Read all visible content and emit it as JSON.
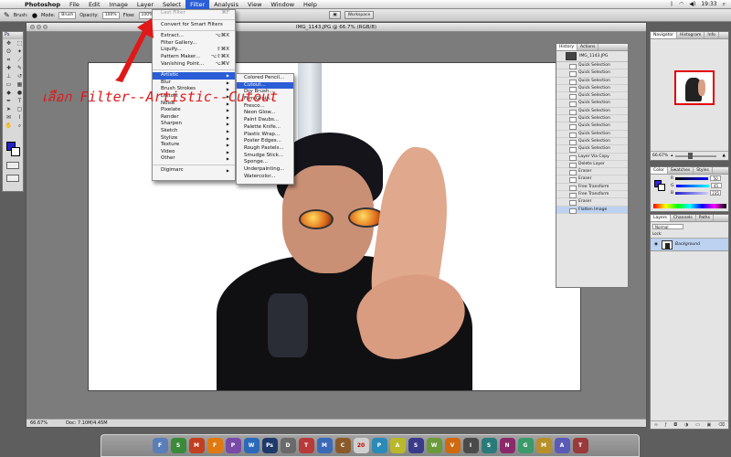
{
  "menubar": {
    "app": "Photoshop",
    "items": [
      "File",
      "Edit",
      "Image",
      "Layer",
      "Select",
      "Filter",
      "Analysis",
      "View",
      "Window",
      "Help"
    ],
    "active_item": "Filter",
    "clock": "19:33"
  },
  "options_bar": {
    "brush_label": "Brush:",
    "mode_label": "Mode:",
    "mode_value": "Brush",
    "opacity_label": "Opacity:",
    "opacity_value": "100%",
    "flow_label": "Flow:",
    "flow_value": "100%",
    "workspace_label": "Workspace"
  },
  "toolbox": {
    "title": "Ps"
  },
  "document": {
    "title": "IMG_1143.JPG @ 66.7% (RGB/8)",
    "zoom": "66.67%",
    "doc_size": "Doc: 7.10M/4.45M"
  },
  "filter_menu": {
    "last_filter": "Last Filter",
    "last_filter_shortcut": "⌘F",
    "convert": "Convert for Smart Filters",
    "top_items": [
      {
        "label": "Extract...",
        "shortcut": "⌥⌘X"
      },
      {
        "label": "Filter Gallery...",
        "shortcut": ""
      },
      {
        "label": "Liquify...",
        "shortcut": "⇧⌘X"
      },
      {
        "label": "Pattern Maker...",
        "shortcut": "⌥⇧⌘X"
      },
      {
        "label": "Vanishing Point...",
        "shortcut": "⌥⌘V"
      }
    ],
    "categories": [
      "Artistic",
      "Blur",
      "Brush Strokes",
      "Distort",
      "Noise",
      "Pixelate",
      "Render",
      "Sharpen",
      "Sketch",
      "Stylize",
      "Texture",
      "Video",
      "Other"
    ],
    "highlighted": "Artistic",
    "bottom": "Digimarc"
  },
  "artistic_submenu": {
    "items": [
      "Colored Pencil...",
      "Cutout...",
      "Dry Brush...",
      "Film Grain...",
      "Fresco...",
      "Neon Glow...",
      "Paint Daubs...",
      "Palette Knife...",
      "Plastic Wrap...",
      "Poster Edges...",
      "Rough Pastels...",
      "Smudge Stick...",
      "Sponge...",
      "Underpainting...",
      "Watercolor..."
    ],
    "highlighted": "Cutout..."
  },
  "annotation": {
    "text": "เลือก Filter--Artistic--Cutout",
    "color": "#e01818"
  },
  "history": {
    "tabs": [
      "History",
      "Actions"
    ],
    "snapshot": "IMG_1143.JPG",
    "states": [
      "Quick Selection",
      "Quick Selection",
      "Quick Selection",
      "Quick Selection",
      "Quick Selection",
      "Quick Selection",
      "Quick Selection",
      "Quick Selection",
      "Quick Selection",
      "Quick Selection",
      "Quick Selection",
      "Quick Selection",
      "Layer Via Copy",
      "Delete Layer",
      "Eraser",
      "Eraser",
      "Free Transform",
      "Free Transform",
      "Eraser",
      "Flatten Image"
    ],
    "selected_index": 19
  },
  "navigator": {
    "tabs": [
      "Navigator",
      "Histogram",
      "Info"
    ],
    "zoom": "66.67%"
  },
  "color_panel": {
    "tabs": [
      "Color",
      "Swatches",
      "Styles"
    ],
    "channels": [
      {
        "label": "R",
        "value": "50"
      },
      {
        "label": "G",
        "value": "45"
      },
      {
        "label": "B",
        "value": "235"
      }
    ]
  },
  "layers": {
    "tabs": [
      "Layers",
      "Channels",
      "Paths"
    ],
    "blend": "Normal",
    "lock_label": "Lock:",
    "layer_name": "Background"
  },
  "dock": {
    "icons": [
      "F",
      "S",
      "M",
      "F",
      "P",
      "W",
      "Ps",
      "D",
      "T",
      "M",
      "C",
      "20",
      "P",
      "A",
      "S",
      "W",
      "V",
      "I",
      "S",
      "N",
      "G",
      "M",
      "A",
      "T"
    ]
  }
}
